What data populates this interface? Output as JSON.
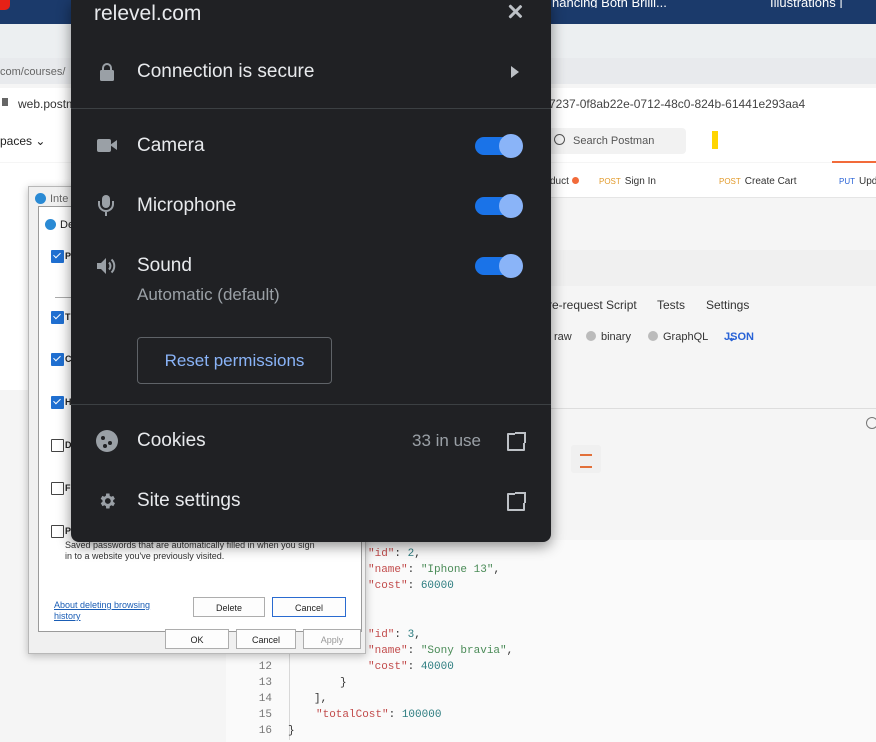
{
  "popup": {
    "site": "relevel.com",
    "connection": "Connection is secure",
    "permissions": [
      {
        "label": "Camera",
        "enabled": true,
        "icon": "camera-icon"
      },
      {
        "label": "Microphone",
        "enabled": true,
        "icon": "microphone-icon"
      },
      {
        "label": "Sound",
        "sub": "Automatic (default)",
        "enabled": true,
        "icon": "speaker-icon"
      }
    ],
    "reset": "Reset permissions",
    "cookies": {
      "label": "Cookies",
      "count": "33 in use"
    },
    "site_settings": "Site settings",
    "colors": {
      "bg": "#202124",
      "accent": "#8ab4f8",
      "toggle_track": "#1a73e8"
    }
  },
  "browser": {
    "breadcrumb": "com/courses/",
    "address_host": "web.postma",
    "address_tail": "7237-0f8ab22e-0712-48c0-824b-61441e293aa4"
  },
  "postman": {
    "workspace": "paces",
    "search_placeholder": "Search Postman",
    "tabs": [
      {
        "method": "",
        "name": "duct"
      },
      {
        "method": "POST",
        "name": "Sign In"
      },
      {
        "method": "POST",
        "name": "Create Cart"
      },
      {
        "method": "PUT",
        "name": "Upd"
      }
    ],
    "subtabs": [
      "re-request Script",
      "Tests",
      "Settings"
    ],
    "body_opts": [
      "raw",
      "binary",
      "GraphQL"
    ],
    "json_label": "JSON",
    "code_lines": [
      {
        "no": "",
        "key": "\"id\"",
        "sep": ": ",
        "val": "2",
        "type": "n",
        "end": ","
      },
      {
        "no": "",
        "key": "\"name\"",
        "sep": ": ",
        "val": "\"Iphone 13\"",
        "type": "s",
        "end": ","
      },
      {
        "no": "",
        "key": "\"cost\"",
        "sep": ": ",
        "val": "60000",
        "type": "n",
        "end": ""
      },
      {
        "no": "",
        "key": "\"id\"",
        "sep": ": ",
        "val": "3",
        "type": "n",
        "end": ","
      },
      {
        "no": "",
        "key": "\"name\"",
        "sep": ": ",
        "val": "\"Sony bravia\"",
        "type": "s",
        "end": ","
      },
      {
        "no": "12",
        "key": "\"cost\"",
        "sep": ": ",
        "val": "40000",
        "type": "n",
        "end": ""
      },
      {
        "no": "13",
        "punct": "}"
      },
      {
        "no": "14",
        "punct": "],"
      },
      {
        "no": "15",
        "key": "\"totalCost\"",
        "sep": ": ",
        "val": "100000",
        "type": "n",
        "end": ""
      },
      {
        "no": "16",
        "punct": "}"
      }
    ]
  },
  "dialog": {
    "outer_title": "Inte",
    "inner_title": "De",
    "items": [
      {
        "letter": "P",
        "checked": true
      },
      {
        "letter": "T",
        "checked": true
      },
      {
        "letter": "C",
        "checked": true
      },
      {
        "letter": "H",
        "checked": true
      },
      {
        "letter": "D",
        "checked": false
      },
      {
        "letter": "F",
        "checked": false
      },
      {
        "letter": "P",
        "checked": false
      }
    ],
    "password_desc_1": "Saved passwords that are automatically filled in when you sign",
    "password_desc_2": "in to a website you've previously visited.",
    "about_link_1": "About deleting browsing",
    "about_link_2": "history",
    "delete": "Delete",
    "cancel": "Cancel",
    "ok": "OK",
    "cancel2": "Cancel",
    "apply": "Apply"
  },
  "top_strip": {
    "tab_a": "nancing Both Brilli...",
    "tab_b": "Illustrations |"
  }
}
